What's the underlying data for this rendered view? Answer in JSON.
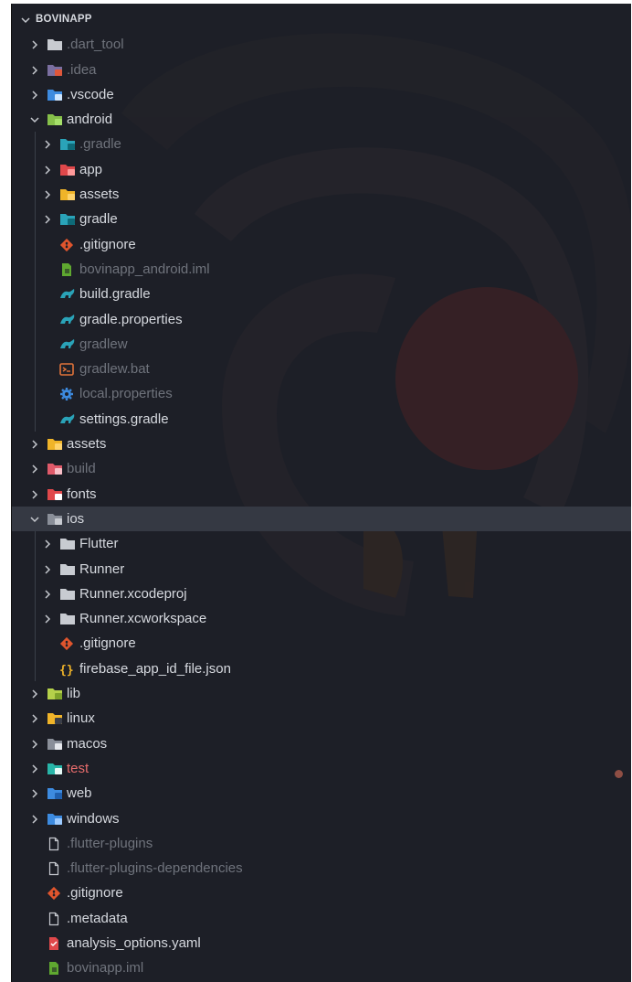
{
  "explorer": {
    "root": {
      "label": "BOVINAPP",
      "expanded": true
    },
    "rows": [
      {
        "label": ".dart_tool",
        "depth": 1,
        "kind": "folder",
        "icon": "folder-gray-icon",
        "expanded": false,
        "state": "dim"
      },
      {
        "label": ".idea",
        "depth": 1,
        "kind": "folder",
        "icon": "folder-idea-icon",
        "expanded": false,
        "state": "dim"
      },
      {
        "label": ".vscode",
        "depth": 1,
        "kind": "folder",
        "icon": "folder-vscode-icon",
        "expanded": false,
        "state": "normal"
      },
      {
        "label": "android",
        "depth": 1,
        "kind": "folder",
        "icon": "folder-android-icon",
        "expanded": true,
        "state": "normal"
      },
      {
        "label": ".gradle",
        "depth": 2,
        "kind": "folder",
        "icon": "folder-gradle-icon",
        "expanded": false,
        "state": "dim"
      },
      {
        "label": "app",
        "depth": 2,
        "kind": "folder",
        "icon": "folder-app-icon",
        "expanded": false,
        "state": "normal"
      },
      {
        "label": "assets",
        "depth": 2,
        "kind": "folder",
        "icon": "folder-assets-icon",
        "expanded": false,
        "state": "normal"
      },
      {
        "label": "gradle",
        "depth": 2,
        "kind": "folder",
        "icon": "folder-gradle-icon",
        "expanded": false,
        "state": "normal"
      },
      {
        "label": ".gitignore",
        "depth": 2,
        "kind": "file",
        "icon": "git-icon",
        "state": "normal"
      },
      {
        "label": "bovinapp_android.iml",
        "depth": 2,
        "kind": "file",
        "icon": "android-file-icon",
        "state": "dim"
      },
      {
        "label": "build.gradle",
        "depth": 2,
        "kind": "file",
        "icon": "gradle-icon",
        "state": "normal"
      },
      {
        "label": "gradle.properties",
        "depth": 2,
        "kind": "file",
        "icon": "gradle-icon",
        "state": "normal"
      },
      {
        "label": "gradlew",
        "depth": 2,
        "kind": "file",
        "icon": "gradle-icon",
        "state": "dim"
      },
      {
        "label": "gradlew.bat",
        "depth": 2,
        "kind": "file",
        "icon": "terminal-icon",
        "state": "dim"
      },
      {
        "label": "local.properties",
        "depth": 2,
        "kind": "file",
        "icon": "gear-icon",
        "state": "dim"
      },
      {
        "label": "settings.gradle",
        "depth": 2,
        "kind": "file",
        "icon": "gradle-icon",
        "state": "normal"
      },
      {
        "label": "assets",
        "depth": 1,
        "kind": "folder",
        "icon": "folder-assets-icon",
        "expanded": false,
        "state": "normal"
      },
      {
        "label": "build",
        "depth": 1,
        "kind": "folder",
        "icon": "folder-build-icon",
        "expanded": false,
        "state": "dim"
      },
      {
        "label": "fonts",
        "depth": 1,
        "kind": "folder",
        "icon": "folder-fonts-icon",
        "expanded": false,
        "state": "normal"
      },
      {
        "label": "ios",
        "depth": 1,
        "kind": "folder",
        "icon": "folder-ios-icon",
        "expanded": true,
        "state": "selected"
      },
      {
        "label": "Flutter",
        "depth": 2,
        "kind": "folder",
        "icon": "folder-gray-icon",
        "expanded": false,
        "state": "normal"
      },
      {
        "label": "Runner",
        "depth": 2,
        "kind": "folder",
        "icon": "folder-gray-icon",
        "expanded": false,
        "state": "normal"
      },
      {
        "label": "Runner.xcodeproj",
        "depth": 2,
        "kind": "folder",
        "icon": "folder-gray-icon",
        "expanded": false,
        "state": "normal"
      },
      {
        "label": "Runner.xcworkspace",
        "depth": 2,
        "kind": "folder",
        "icon": "folder-gray-icon",
        "expanded": false,
        "state": "normal"
      },
      {
        "label": ".gitignore",
        "depth": 2,
        "kind": "file",
        "icon": "git-icon",
        "state": "normal"
      },
      {
        "label": "firebase_app_id_file.json",
        "depth": 2,
        "kind": "file",
        "icon": "json-icon",
        "state": "normal"
      },
      {
        "label": "lib",
        "depth": 1,
        "kind": "folder",
        "icon": "folder-lib-icon",
        "expanded": false,
        "state": "normal"
      },
      {
        "label": "linux",
        "depth": 1,
        "kind": "folder",
        "icon": "folder-linux-icon",
        "expanded": false,
        "state": "normal"
      },
      {
        "label": "macos",
        "depth": 1,
        "kind": "folder",
        "icon": "folder-macos-icon",
        "expanded": false,
        "state": "normal"
      },
      {
        "label": "test",
        "depth": 1,
        "kind": "folder",
        "icon": "folder-test-icon",
        "expanded": false,
        "state": "red"
      },
      {
        "label": "web",
        "depth": 1,
        "kind": "folder",
        "icon": "folder-web-icon",
        "expanded": false,
        "state": "normal"
      },
      {
        "label": "windows",
        "depth": 1,
        "kind": "folder",
        "icon": "folder-windows-icon",
        "expanded": false,
        "state": "normal"
      },
      {
        "label": ".flutter-plugins",
        "depth": 1,
        "kind": "file",
        "icon": "file-icon",
        "state": "dim"
      },
      {
        "label": ".flutter-plugins-dependencies",
        "depth": 1,
        "kind": "file",
        "icon": "file-icon",
        "state": "dim"
      },
      {
        "label": ".gitignore",
        "depth": 1,
        "kind": "file",
        "icon": "git-icon",
        "state": "normal"
      },
      {
        "label": ".metadata",
        "depth": 1,
        "kind": "file",
        "icon": "file-icon",
        "state": "normal"
      },
      {
        "label": "analysis_options.yaml",
        "depth": 1,
        "kind": "file",
        "icon": "yaml-icon",
        "state": "normal"
      },
      {
        "label": "bovinapp.iml",
        "depth": 1,
        "kind": "file",
        "icon": "android-file-icon",
        "state": "dim"
      }
    ]
  },
  "colors": {
    "background": "#1d1f27",
    "selected_row": "#353943",
    "text": "#d6d9df",
    "text_dim": "#6f737c",
    "text_error": "#e66c6c"
  }
}
